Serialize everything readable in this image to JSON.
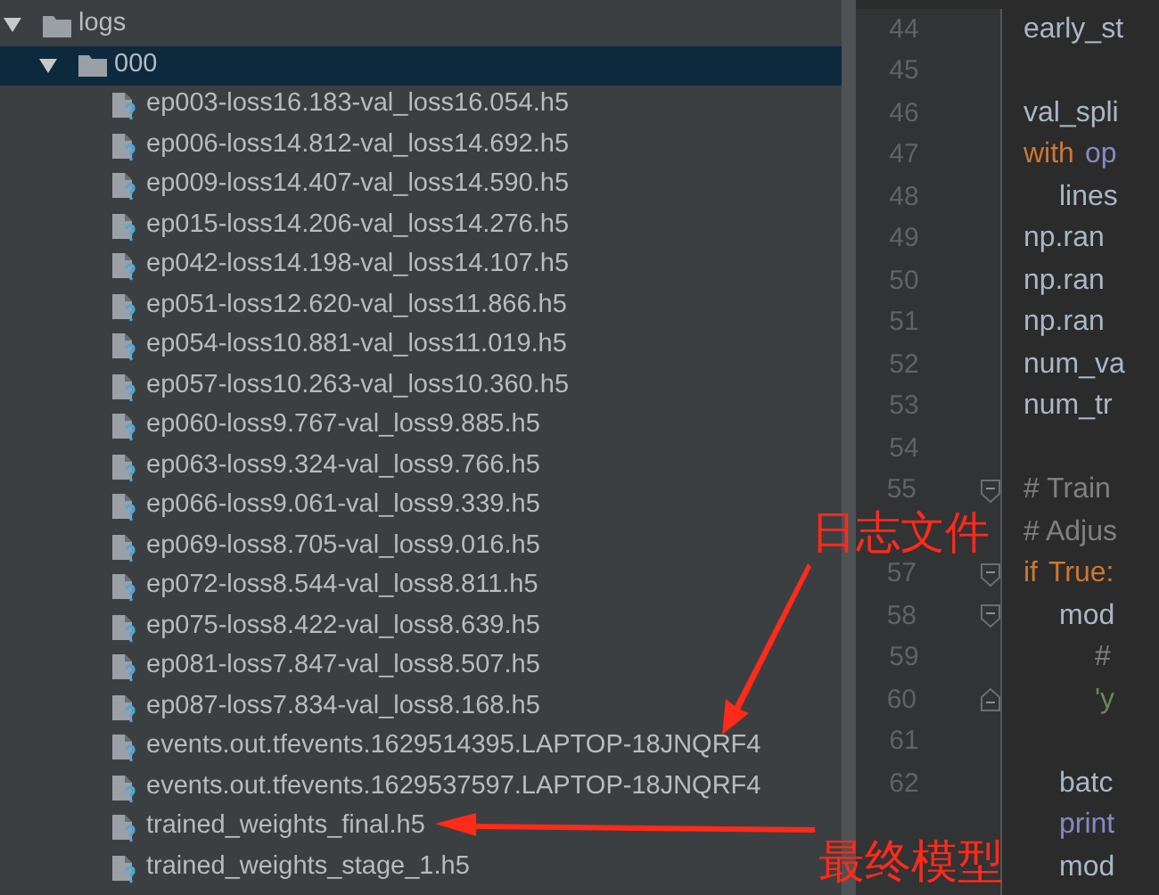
{
  "project_tree": {
    "items": [
      {
        "name": "logs",
        "kind": "folder",
        "expanded": true,
        "selected": false,
        "children": [
          {
            "name": "000",
            "kind": "folder",
            "expanded": true,
            "selected": true,
            "children": [
              {
                "name": "ep003-loss16.183-val_loss16.054.h5",
                "kind": "file",
                "selected": false
              },
              {
                "name": "ep006-loss14.812-val_loss14.692.h5",
                "kind": "file",
                "selected": false
              },
              {
                "name": "ep009-loss14.407-val_loss14.590.h5",
                "kind": "file",
                "selected": false
              },
              {
                "name": "ep015-loss14.206-val_loss14.276.h5",
                "kind": "file",
                "selected": false
              },
              {
                "name": "ep042-loss14.198-val_loss14.107.h5",
                "kind": "file",
                "selected": false
              },
              {
                "name": "ep051-loss12.620-val_loss11.866.h5",
                "kind": "file",
                "selected": false
              },
              {
                "name": "ep054-loss10.881-val_loss11.019.h5",
                "kind": "file",
                "selected": false
              },
              {
                "name": "ep057-loss10.263-val_loss10.360.h5",
                "kind": "file",
                "selected": false
              },
              {
                "name": "ep060-loss9.767-val_loss9.885.h5",
                "kind": "file",
                "selected": false
              },
              {
                "name": "ep063-loss9.324-val_loss9.766.h5",
                "kind": "file",
                "selected": false
              },
              {
                "name": "ep066-loss9.061-val_loss9.339.h5",
                "kind": "file",
                "selected": false
              },
              {
                "name": "ep069-loss8.705-val_loss9.016.h5",
                "kind": "file",
                "selected": false
              },
              {
                "name": "ep072-loss8.544-val_loss8.811.h5",
                "kind": "file",
                "selected": false
              },
              {
                "name": "ep075-loss8.422-val_loss8.639.h5",
                "kind": "file",
                "selected": false
              },
              {
                "name": "ep081-loss7.847-val_loss8.507.h5",
                "kind": "file",
                "selected": false
              },
              {
                "name": "ep087-loss7.834-val_loss8.168.h5",
                "kind": "file",
                "selected": false
              },
              {
                "name": "events.out.tfevents.1629514395.LAPTOP-18JNQRF4",
                "kind": "file",
                "selected": false
              },
              {
                "name": "events.out.tfevents.1629537597.LAPTOP-18JNQRF4",
                "kind": "file",
                "selected": false
              },
              {
                "name": "trained_weights_final.h5",
                "kind": "file",
                "selected": false
              },
              {
                "name": "trained_weights_stage_1.h5",
                "kind": "file",
                "selected": false
              }
            ]
          }
        ]
      }
    ]
  },
  "editor": {
    "lines": [
      {
        "number": "44",
        "kind": "plain",
        "tokens": [
          {
            "text": "early_st",
            "kind": "plain"
          }
        ]
      },
      {
        "number": "45",
        "kind": "plain"
      },
      {
        "number": "46",
        "kind": "plain",
        "tokens": [
          {
            "text": "val_spli",
            "kind": "plain"
          }
        ]
      },
      {
        "number": "47",
        "kind": "plain",
        "tokens": [
          {
            "text": "with",
            "kind": "keyword"
          },
          {
            "text": "op",
            "kind": "builtin"
          }
        ],
        "children": [
          {
            "number": "48",
            "kind": "plain",
            "tokens": [
              {
                "text": "lines",
                "kind": "plain"
              }
            ]
          }
        ]
      },
      {
        "number": "49",
        "kind": "plain",
        "tokens": [
          {
            "text": "np.ran",
            "kind": "plain"
          }
        ]
      },
      {
        "number": "50",
        "kind": "plain",
        "tokens": [
          {
            "text": "np.ran",
            "kind": "plain"
          }
        ]
      },
      {
        "number": "51",
        "kind": "plain",
        "tokens": [
          {
            "text": "np.ran",
            "kind": "plain"
          }
        ]
      },
      {
        "number": "52",
        "kind": "plain",
        "tokens": [
          {
            "text": "num_va",
            "kind": "plain"
          }
        ]
      },
      {
        "number": "53",
        "kind": "plain",
        "tokens": [
          {
            "text": "num_tr",
            "kind": "plain"
          }
        ]
      },
      {
        "number": "54",
        "kind": "plain"
      },
      {
        "number": "55",
        "kind": "fold_start",
        "tokens": [
          {
            "text": "# Train",
            "kind": "comment"
          }
        ]
      },
      {
        "kind": "plain",
        "tokens": [
          {
            "text": "# Adjus",
            "kind": "comment"
          }
        ]
      },
      {
        "number": "57",
        "kind": "fold_start",
        "tokens": [
          {
            "text": "if",
            "kind": "keyword"
          },
          {
            "text": "True:",
            "kind": "keyword"
          }
        ],
        "children": [
          {
            "number": "58",
            "kind": "fold_start",
            "tokens": [
              {
                "text": "mod",
                "kind": "plain"
              }
            ],
            "children": [
              {
                "number": "59",
                "kind": "plain",
                "tokens": [
                  {
                    "text": "#",
                    "kind": "comment"
                  }
                ]
              },
              {
                "number": "60",
                "kind": "fold_end",
                "tokens": [
                  {
                    "text": "'y",
                    "kind": "string"
                  }
                ]
              }
            ]
          },
          {
            "number": "61",
            "kind": "plain"
          },
          {
            "number": "62",
            "kind": "plain",
            "tokens": [
              {
                "text": "batc",
                "kind": "plain"
              }
            ]
          },
          {
            "kind": "plain",
            "tokens": [
              {
                "text": "print",
                "kind": "builtin"
              }
            ]
          },
          {
            "kind": "plain",
            "tokens": [
              {
                "text": "mod",
                "kind": "plain"
              }
            ]
          }
        ]
      }
    ]
  },
  "annotations": [
    {
      "text": "日志文件"
    },
    {
      "text": "最终模型"
    }
  ]
}
